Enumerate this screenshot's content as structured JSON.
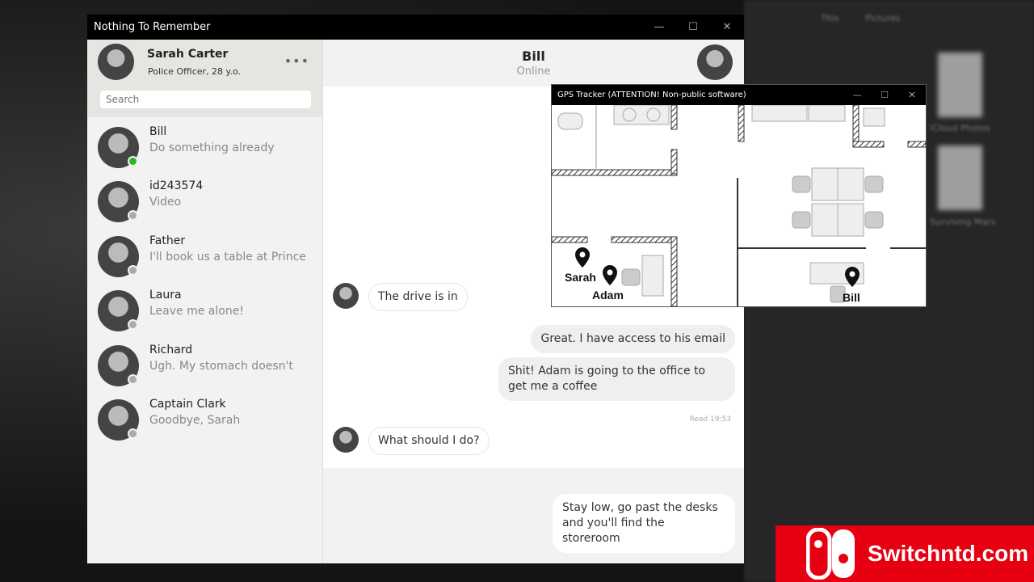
{
  "app": {
    "title": "Nothing To Remember"
  },
  "profile": {
    "name": "Sarah Carter",
    "role": "Police Officer, 28 y.o.",
    "search_placeholder": "Search"
  },
  "contacts": [
    {
      "name": "Bill",
      "last": "Do something already",
      "status": "online"
    },
    {
      "name": "id243574",
      "last": "Video",
      "status": "offline"
    },
    {
      "name": "Father",
      "last": "I'll book us a table at Prince",
      "status": "offline"
    },
    {
      "name": "Laura",
      "last": "Leave me alone!",
      "status": "offline"
    },
    {
      "name": "Richard",
      "last": "Ugh. My stomach doesn't",
      "status": "offline"
    },
    {
      "name": "Captain Clark",
      "last": "Goodbye, Sarah",
      "status": "offline"
    }
  ],
  "chat": {
    "name": "Bill",
    "status": "Online",
    "messages": [
      {
        "from": "Bill",
        "text": "The drive is in"
      },
      {
        "from": "me",
        "text": "Great. I have access to his email"
      },
      {
        "from": "me",
        "text": "Shit! Adam is going to the office to get me a coffee"
      },
      {
        "from": "Bill",
        "text": "What should I do?"
      }
    ],
    "read": "Read 19:53",
    "option": "Stay low, go past the desks and you'll find the storeroom"
  },
  "gps": {
    "title": "GPS Tracker (ATTENTION! Non-public software)",
    "pins": [
      "Sarah",
      "Adam",
      "Bill"
    ]
  },
  "background": {
    "labels": [
      "This",
      "Pictures",
      "iCloud Photos",
      "Surviving Mars"
    ]
  },
  "watermark": "Switchntd.com",
  "colors": {
    "online": "#27b827",
    "watermark": "#e60012"
  }
}
